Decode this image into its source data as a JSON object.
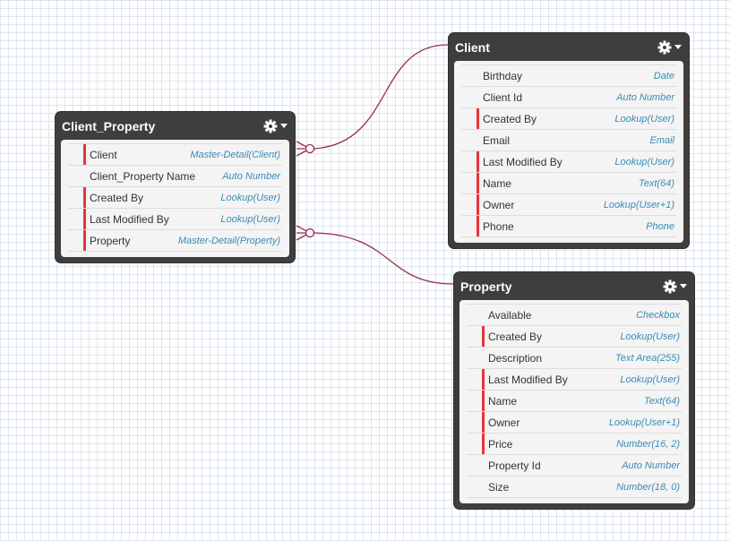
{
  "colors": {
    "required_marker": "#e8333a",
    "link": "#9b2b52",
    "type_text": "#3a8bb5",
    "header_bg": "#3e3e3e"
  },
  "objects": {
    "client_property": {
      "title": "Client_Property",
      "fields": [
        {
          "name": "Client",
          "type": "Master-Detail(Client)",
          "required": true
        },
        {
          "name": "Client_Property Name",
          "type": "Auto Number",
          "required": false
        },
        {
          "name": "Created By",
          "type": "Lookup(User)",
          "required": true
        },
        {
          "name": "Last Modified By",
          "type": "Lookup(User)",
          "required": true
        },
        {
          "name": "Property",
          "type": "Master-Detail(Property)",
          "required": true
        }
      ]
    },
    "client": {
      "title": "Client",
      "fields": [
        {
          "name": "Birthday",
          "type": "Date",
          "required": false
        },
        {
          "name": "Client Id",
          "type": "Auto Number",
          "required": false
        },
        {
          "name": "Created By",
          "type": "Lookup(User)",
          "required": true
        },
        {
          "name": "Email",
          "type": "Email",
          "required": false
        },
        {
          "name": "Last Modified By",
          "type": "Lookup(User)",
          "required": true
        },
        {
          "name": "Name",
          "type": "Text(64)",
          "required": true
        },
        {
          "name": "Owner",
          "type": "Lookup(User+1)",
          "required": true
        },
        {
          "name": "Phone",
          "type": "Phone",
          "required": true
        }
      ]
    },
    "property": {
      "title": "Property",
      "fields": [
        {
          "name": "Available",
          "type": "Checkbox",
          "required": false
        },
        {
          "name": "Created By",
          "type": "Lookup(User)",
          "required": true
        },
        {
          "name": "Description",
          "type": "Text Area(255)",
          "required": false
        },
        {
          "name": "Last Modified By",
          "type": "Lookup(User)",
          "required": true
        },
        {
          "name": "Name",
          "type": "Text(64)",
          "required": true
        },
        {
          "name": "Owner",
          "type": "Lookup(User+1)",
          "required": true
        },
        {
          "name": "Price",
          "type": "Number(16, 2)",
          "required": true
        },
        {
          "name": "Property Id",
          "type": "Auto Number",
          "required": false
        },
        {
          "name": "Size",
          "type": "Number(18, 0)",
          "required": false
        }
      ]
    }
  },
  "relationships": [
    {
      "from": "client_property",
      "to": "client",
      "field": "Client"
    },
    {
      "from": "client_property",
      "to": "property",
      "field": "Property"
    }
  ]
}
